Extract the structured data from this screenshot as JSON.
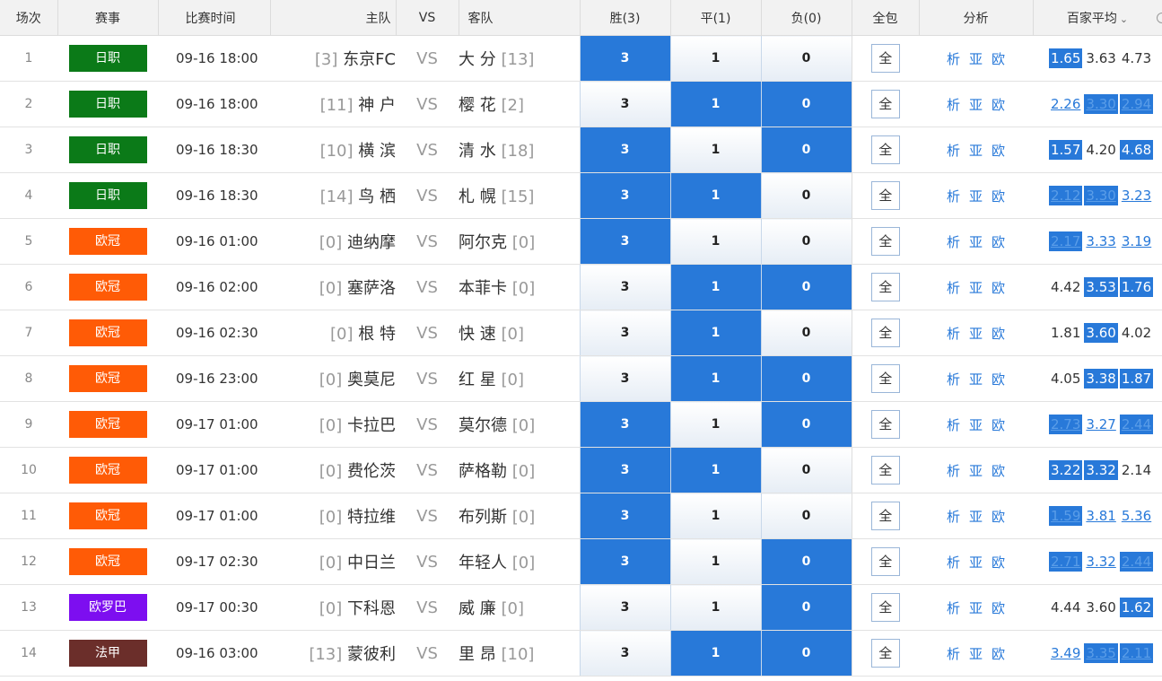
{
  "header": {
    "num": "场次",
    "league": "赛事",
    "time": "比赛时间",
    "home": "主队",
    "vs": "VS",
    "away": "客队",
    "win": "胜(3)",
    "draw": "平(1)",
    "lose": "负(0)",
    "all": "全包",
    "analysis": "分析",
    "avg": "百家平均"
  },
  "colors": {
    "jleague": "#0b7a18",
    "ucl": "#ff5b06",
    "uel": "#7d0ef0",
    "ligue1": "#6b2e2a",
    "accent": "#2879d9"
  },
  "matches": [
    {
      "num": "1",
      "league": "日职",
      "league_color": "#0b7a18",
      "time": "09-16 18:00",
      "home_rank": "[3]",
      "home": "东京FC",
      "vs": "VS",
      "away": "大 分",
      "away_rank": "[13]",
      "win": "3",
      "draw": "1",
      "lose": "0",
      "sel": [
        true,
        false,
        false
      ],
      "all": "全",
      "ana": [
        "析",
        "亚",
        "欧"
      ],
      "odds": [
        {
          "v": "1.65",
          "hl": true,
          "ul": false
        },
        {
          "v": "3.63",
          "hl": false,
          "ul": false
        },
        {
          "v": "4.73",
          "hl": false,
          "ul": false
        }
      ]
    },
    {
      "num": "2",
      "league": "日职",
      "league_color": "#0b7a18",
      "time": "09-16 18:00",
      "home_rank": "[11]",
      "home": "神 户",
      "vs": "VS",
      "away": "樱 花",
      "away_rank": "[2]",
      "win": "3",
      "draw": "1",
      "lose": "0",
      "sel": [
        false,
        true,
        true
      ],
      "all": "全",
      "ana": [
        "析",
        "亚",
        "欧"
      ],
      "odds": [
        {
          "v": "2.26",
          "hl": false,
          "ul": true
        },
        {
          "v": "3.30",
          "hl": true,
          "ul": true
        },
        {
          "v": "2.94",
          "hl": true,
          "ul": true
        }
      ]
    },
    {
      "num": "3",
      "league": "日职",
      "league_color": "#0b7a18",
      "time": "09-16 18:30",
      "home_rank": "[10]",
      "home": "横 滨",
      "vs": "VS",
      "away": "清 水",
      "away_rank": "[18]",
      "win": "3",
      "draw": "1",
      "lose": "0",
      "sel": [
        true,
        false,
        true
      ],
      "all": "全",
      "ana": [
        "析",
        "亚",
        "欧"
      ],
      "odds": [
        {
          "v": "1.57",
          "hl": true,
          "ul": false
        },
        {
          "v": "4.20",
          "hl": false,
          "ul": false
        },
        {
          "v": "4.68",
          "hl": true,
          "ul": false
        }
      ]
    },
    {
      "num": "4",
      "league": "日职",
      "league_color": "#0b7a18",
      "time": "09-16 18:30",
      "home_rank": "[14]",
      "home": "鸟 栖",
      "vs": "VS",
      "away": "札 幌",
      "away_rank": "[15]",
      "win": "3",
      "draw": "1",
      "lose": "0",
      "sel": [
        true,
        true,
        false
      ],
      "all": "全",
      "ana": [
        "析",
        "亚",
        "欧"
      ],
      "odds": [
        {
          "v": "2.12",
          "hl": true,
          "ul": true
        },
        {
          "v": "3.30",
          "hl": true,
          "ul": true
        },
        {
          "v": "3.23",
          "hl": false,
          "ul": true
        }
      ]
    },
    {
      "num": "5",
      "league": "欧冠",
      "league_color": "#ff5b06",
      "time": "09-16 01:00",
      "home_rank": "[0]",
      "home": "迪纳摩",
      "vs": "VS",
      "away": "阿尔克",
      "away_rank": "[0]",
      "win": "3",
      "draw": "1",
      "lose": "0",
      "sel": [
        true,
        false,
        false
      ],
      "all": "全",
      "ana": [
        "析",
        "亚",
        "欧"
      ],
      "odds": [
        {
          "v": "2.17",
          "hl": true,
          "ul": true
        },
        {
          "v": "3.33",
          "hl": false,
          "ul": true
        },
        {
          "v": "3.19",
          "hl": false,
          "ul": true
        }
      ]
    },
    {
      "num": "6",
      "league": "欧冠",
      "league_color": "#ff5b06",
      "time": "09-16 02:00",
      "home_rank": "[0]",
      "home": "塞萨洛",
      "vs": "VS",
      "away": "本菲卡",
      "away_rank": "[0]",
      "win": "3",
      "draw": "1",
      "lose": "0",
      "sel": [
        false,
        true,
        true
      ],
      "all": "全",
      "ana": [
        "析",
        "亚",
        "欧"
      ],
      "odds": [
        {
          "v": "4.42",
          "hl": false,
          "ul": false
        },
        {
          "v": "3.53",
          "hl": true,
          "ul": false
        },
        {
          "v": "1.76",
          "hl": true,
          "ul": false
        }
      ]
    },
    {
      "num": "7",
      "league": "欧冠",
      "league_color": "#ff5b06",
      "time": "09-16 02:30",
      "home_rank": "[0]",
      "home": "根 特",
      "vs": "VS",
      "away": "快 速",
      "away_rank": "[0]",
      "win": "3",
      "draw": "1",
      "lose": "0",
      "sel": [
        false,
        true,
        false
      ],
      "all": "全",
      "ana": [
        "析",
        "亚",
        "欧"
      ],
      "odds": [
        {
          "v": "1.81",
          "hl": false,
          "ul": false
        },
        {
          "v": "3.60",
          "hl": true,
          "ul": false
        },
        {
          "v": "4.02",
          "hl": false,
          "ul": false
        }
      ]
    },
    {
      "num": "8",
      "league": "欧冠",
      "league_color": "#ff5b06",
      "time": "09-16 23:00",
      "home_rank": "[0]",
      "home": "奥莫尼",
      "vs": "VS",
      "away": "红 星",
      "away_rank": "[0]",
      "win": "3",
      "draw": "1",
      "lose": "0",
      "sel": [
        false,
        true,
        true
      ],
      "all": "全",
      "ana": [
        "析",
        "亚",
        "欧"
      ],
      "odds": [
        {
          "v": "4.05",
          "hl": false,
          "ul": false
        },
        {
          "v": "3.38",
          "hl": true,
          "ul": false
        },
        {
          "v": "1.87",
          "hl": true,
          "ul": false
        }
      ]
    },
    {
      "num": "9",
      "league": "欧冠",
      "league_color": "#ff5b06",
      "time": "09-17 01:00",
      "home_rank": "[0]",
      "home": "卡拉巴",
      "vs": "VS",
      "away": "莫尔德",
      "away_rank": "[0]",
      "win": "3",
      "draw": "1",
      "lose": "0",
      "sel": [
        true,
        false,
        true
      ],
      "all": "全",
      "ana": [
        "析",
        "亚",
        "欧"
      ],
      "odds": [
        {
          "v": "2.73",
          "hl": true,
          "ul": true
        },
        {
          "v": "3.27",
          "hl": false,
          "ul": true
        },
        {
          "v": "2.44",
          "hl": true,
          "ul": true
        }
      ]
    },
    {
      "num": "10",
      "league": "欧冠",
      "league_color": "#ff5b06",
      "time": "09-17 01:00",
      "home_rank": "[0]",
      "home": "费伦茨",
      "vs": "VS",
      "away": "萨格勒",
      "away_rank": "[0]",
      "win": "3",
      "draw": "1",
      "lose": "0",
      "sel": [
        true,
        true,
        false
      ],
      "all": "全",
      "ana": [
        "析",
        "亚",
        "欧"
      ],
      "odds": [
        {
          "v": "3.22",
          "hl": true,
          "ul": false
        },
        {
          "v": "3.32",
          "hl": true,
          "ul": false
        },
        {
          "v": "2.14",
          "hl": false,
          "ul": false
        }
      ]
    },
    {
      "num": "11",
      "league": "欧冠",
      "league_color": "#ff5b06",
      "time": "09-17 01:00",
      "home_rank": "[0]",
      "home": "特拉维",
      "vs": "VS",
      "away": "布列斯",
      "away_rank": "[0]",
      "win": "3",
      "draw": "1",
      "lose": "0",
      "sel": [
        true,
        false,
        false
      ],
      "all": "全",
      "ana": [
        "析",
        "亚",
        "欧"
      ],
      "odds": [
        {
          "v": "1.59",
          "hl": true,
          "ul": true
        },
        {
          "v": "3.81",
          "hl": false,
          "ul": true
        },
        {
          "v": "5.36",
          "hl": false,
          "ul": true
        }
      ]
    },
    {
      "num": "12",
      "league": "欧冠",
      "league_color": "#ff5b06",
      "time": "09-17 02:30",
      "home_rank": "[0]",
      "home": "中日兰",
      "vs": "VS",
      "away": "年轻人",
      "away_rank": "[0]",
      "win": "3",
      "draw": "1",
      "lose": "0",
      "sel": [
        true,
        false,
        true
      ],
      "all": "全",
      "ana": [
        "析",
        "亚",
        "欧"
      ],
      "odds": [
        {
          "v": "2.71",
          "hl": true,
          "ul": true
        },
        {
          "v": "3.32",
          "hl": false,
          "ul": true
        },
        {
          "v": "2.44",
          "hl": true,
          "ul": true
        }
      ]
    },
    {
      "num": "13",
      "league": "欧罗巴",
      "league_color": "#7d0ef0",
      "time": "09-17 00:30",
      "home_rank": "[0]",
      "home": "下科恩",
      "vs": "VS",
      "away": "威 廉",
      "away_rank": "[0]",
      "win": "3",
      "draw": "1",
      "lose": "0",
      "sel": [
        false,
        false,
        true
      ],
      "all": "全",
      "ana": [
        "析",
        "亚",
        "欧"
      ],
      "odds": [
        {
          "v": "4.44",
          "hl": false,
          "ul": false
        },
        {
          "v": "3.60",
          "hl": false,
          "ul": false
        },
        {
          "v": "1.62",
          "hl": true,
          "ul": false
        }
      ]
    },
    {
      "num": "14",
      "league": "法甲",
      "league_color": "#6b2e2a",
      "time": "09-16 03:00",
      "home_rank": "[13]",
      "home": "蒙彼利",
      "vs": "VS",
      "away": "里 昂",
      "away_rank": "[10]",
      "win": "3",
      "draw": "1",
      "lose": "0",
      "sel": [
        false,
        true,
        true
      ],
      "all": "全",
      "ana": [
        "析",
        "亚",
        "欧"
      ],
      "odds": [
        {
          "v": "3.49",
          "hl": false,
          "ul": true
        },
        {
          "v": "3.35",
          "hl": true,
          "ul": true
        },
        {
          "v": "2.11",
          "hl": true,
          "ul": true
        }
      ]
    }
  ]
}
